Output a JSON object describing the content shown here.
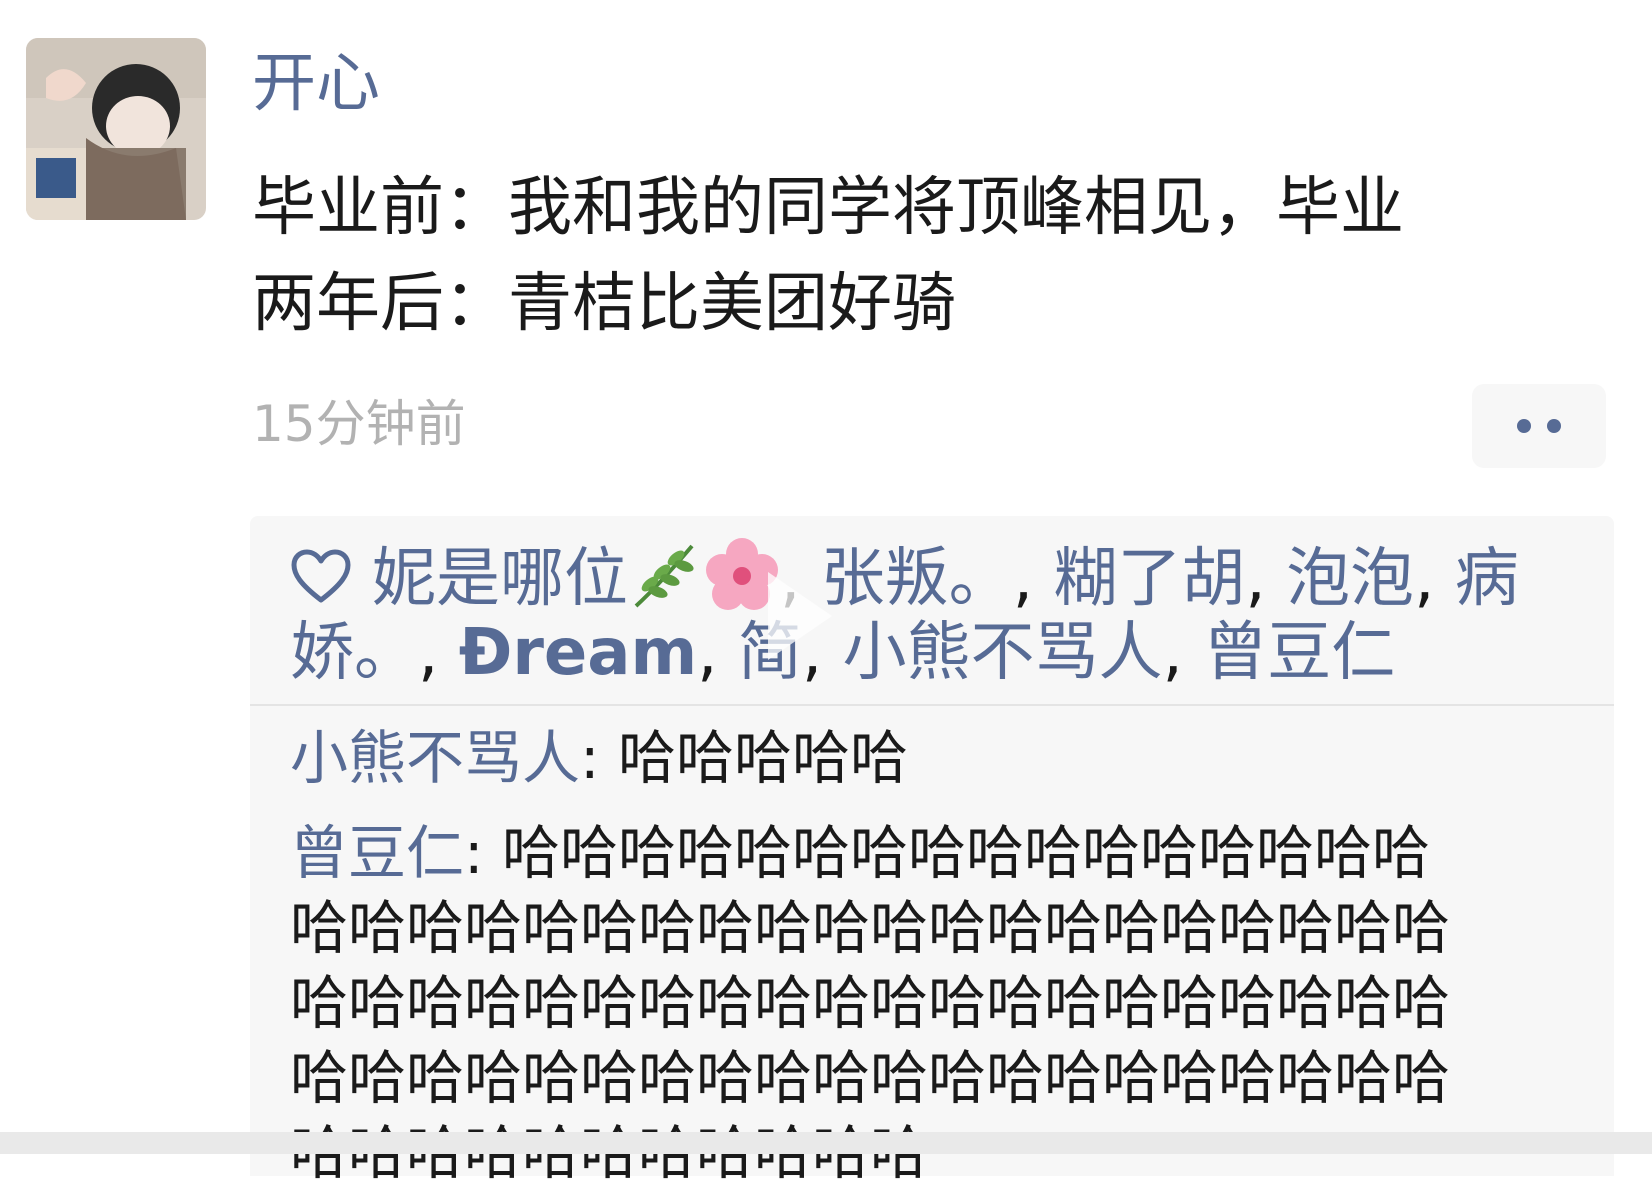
{
  "post": {
    "author": "开心",
    "text_lines": [
      "毕业前：我和我的同学将顶峰相见，毕业",
      "两年后：青桔比美团好骑"
    ],
    "time": "15分钟前"
  },
  "likes": {
    "icon": "heart-outline-icon",
    "line1_names": [
      "妮是哪位"
    ],
    "line1_rest": [
      "张叛。",
      "糊了胡",
      "泡泡",
      "病"
    ],
    "line2": [
      "娇。",
      "Đream",
      "简",
      "小熊不骂人",
      "曾豆仁"
    ],
    "separator": ",",
    "emojis": [
      "herb-emoji",
      "hibiscus-flower-emoji"
    ]
  },
  "comments": [
    {
      "name": "小熊不骂人",
      "colon": ":",
      "text": "哈哈哈哈哈"
    },
    {
      "name": "曾豆仁",
      "colon": ":",
      "lines": [
        "哈哈哈哈哈哈哈哈哈哈哈哈哈哈哈哈",
        "哈哈哈哈哈哈哈哈哈哈哈哈哈哈哈哈哈哈哈哈",
        "哈哈哈哈哈哈哈哈哈哈哈哈哈哈哈哈哈哈哈哈",
        "哈哈哈哈哈哈哈哈哈哈哈哈哈哈哈哈哈哈哈哈",
        "哈哈哈哈哈哈哈哈哈哈哈"
      ]
    }
  ],
  "colors": {
    "link": "#576b95",
    "time": "#b2b2b2",
    "panel": "#f7f7f7"
  }
}
